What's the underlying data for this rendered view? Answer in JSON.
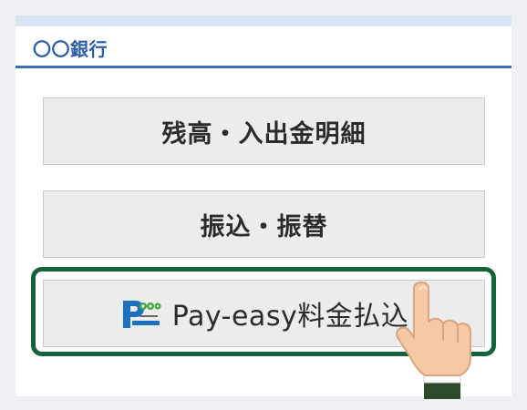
{
  "bank": {
    "name": "〇〇銀行"
  },
  "menu": {
    "items": [
      {
        "label": "残高・入出金明細"
      },
      {
        "label": "振込・振替"
      },
      {
        "label": "Pay-easy料金払込",
        "logo": "pay-easy-logo",
        "logo_text": "ペイジー Pay-easy",
        "highlighted": true
      }
    ]
  },
  "colors": {
    "header_accent": "#3f6fb3",
    "bank_name": "#2f5fa8",
    "highlight_border": "#14643a",
    "button_bg": "#ececec"
  },
  "icons": {
    "pointer": "pointing-hand-icon"
  }
}
